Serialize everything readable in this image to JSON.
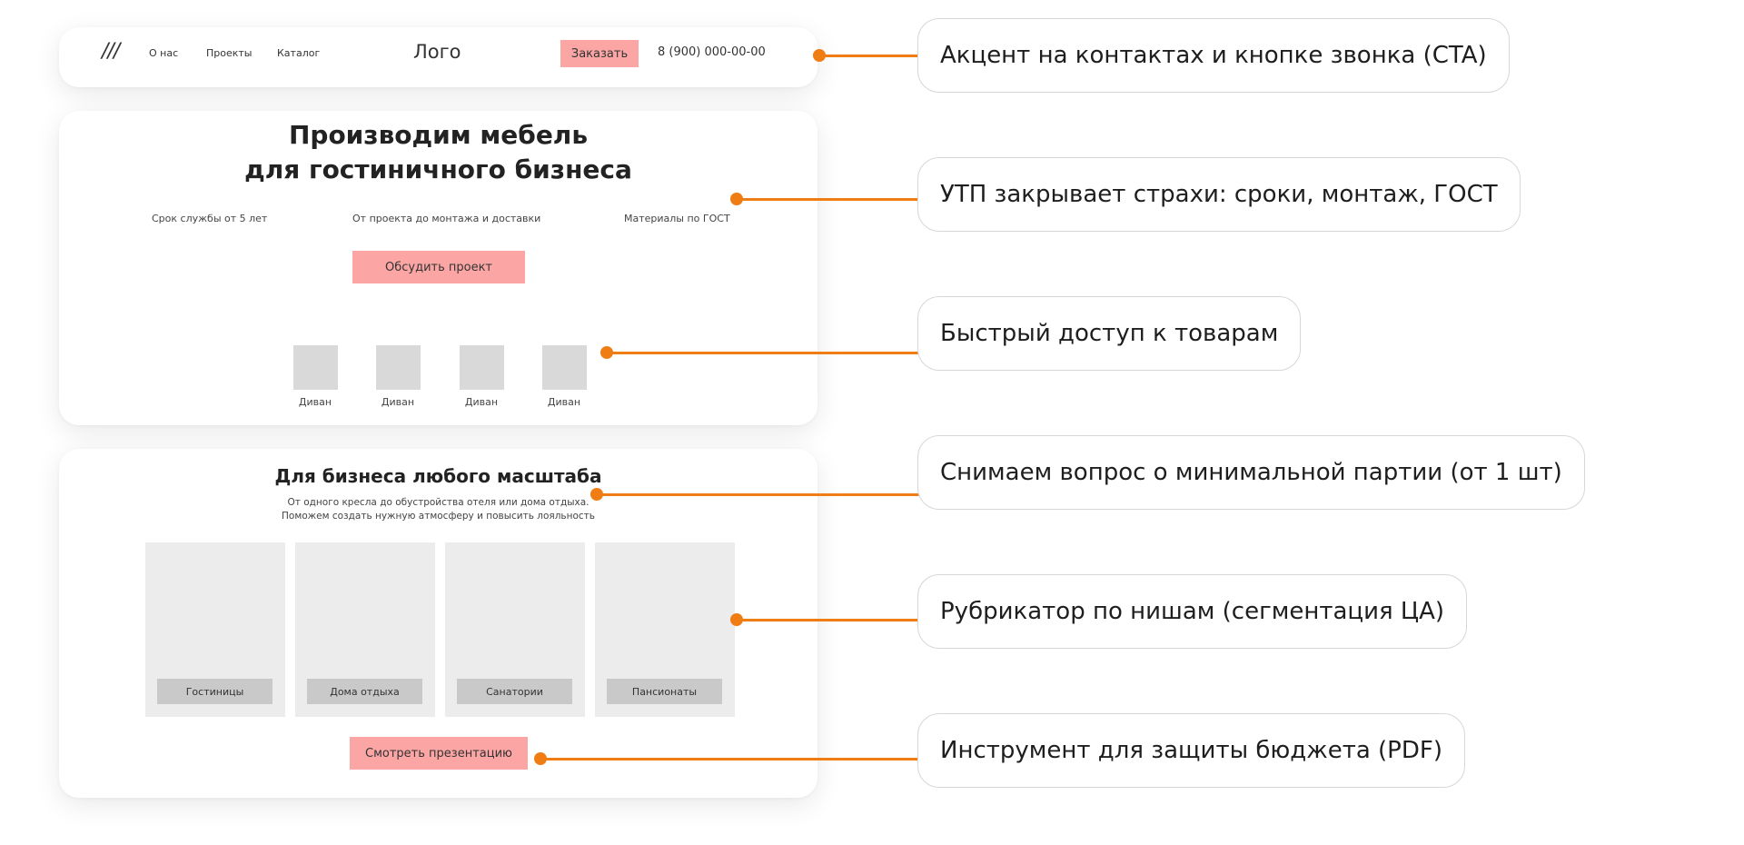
{
  "nav": {
    "menu_icon": "///",
    "links": [
      "О нас",
      "Проекты",
      "Каталог"
    ],
    "logo": "Лого",
    "cta": "Заказать",
    "phone": "8 (900) 000-00-00"
  },
  "hero": {
    "title_line1": "Производим мебель",
    "title_line2": "для гостиничного бизнеса",
    "features": [
      "Срок службы от 5 лет",
      "От проекта до монтажа и доставки",
      "Материалы по ГОСТ"
    ],
    "cta": "Обсудить проект",
    "products": [
      "Диван",
      "Диван",
      "Диван",
      "Диван"
    ]
  },
  "business": {
    "title": "Для бизнеса любого масштаба",
    "subtitle_line1": "От одного кресла до обустройства отеля или дома отдыха.",
    "subtitle_line2": "Поможем создать нужную атмосферу и повысить лояльность",
    "niches": [
      "Гостиницы",
      "Дома отдыха",
      "Санатории",
      "Пансионаты"
    ],
    "cta": "Смотреть презентацию"
  },
  "callouts": [
    "Акцент на контактах и кнопке звонка (CTA)",
    "УТП закрывает страхи: сроки, монтаж, ГОСТ",
    "Быстрый доступ к товарам",
    "Снимаем вопрос о минимальной партии (от 1 шт)",
    "Рубрикатор по нишам (сегментация ЦА)",
    "Инструмент для защиты бюджета (PDF)"
  ],
  "colors": {
    "accent_pink": "#fca5a5",
    "connector_orange": "#ef7d14",
    "placeholder_gray": "#d9d9d9"
  }
}
